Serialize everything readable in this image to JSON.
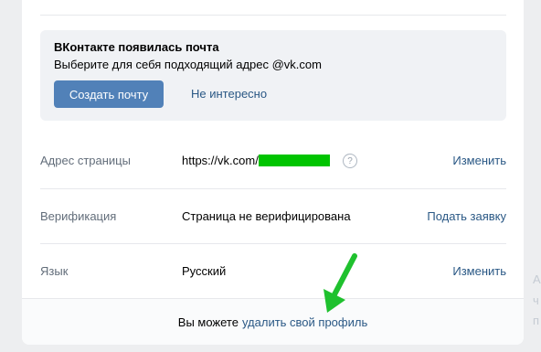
{
  "banner": {
    "title": "ВКонтакте появилась почта",
    "text": "Выберите для себя подходящий адрес @vk.com",
    "primary_button": "Создать почту",
    "secondary_button": "Не интересно"
  },
  "rows": [
    {
      "label": "Адрес страницы",
      "value": "https://vk.com/",
      "action": "Изменить"
    },
    {
      "label": "Верификация",
      "value": "Страница не верифицирована",
      "action": "Подать заявку"
    },
    {
      "label": "Язык",
      "value": "Русский",
      "action": "Изменить"
    }
  ],
  "help_symbol": "?",
  "footer": {
    "prefix": "Вы можете",
    "link": "удалить свой профиль"
  },
  "side_fragments": [
    "А",
    "ч",
    "п"
  ],
  "colors": {
    "accent": "#5181b8",
    "link": "#2a5885",
    "redaction": "#00c400",
    "annotation_arrow": "#1fc12e"
  },
  "icons": [
    "question-icon",
    "arrow-annotation-icon"
  ]
}
